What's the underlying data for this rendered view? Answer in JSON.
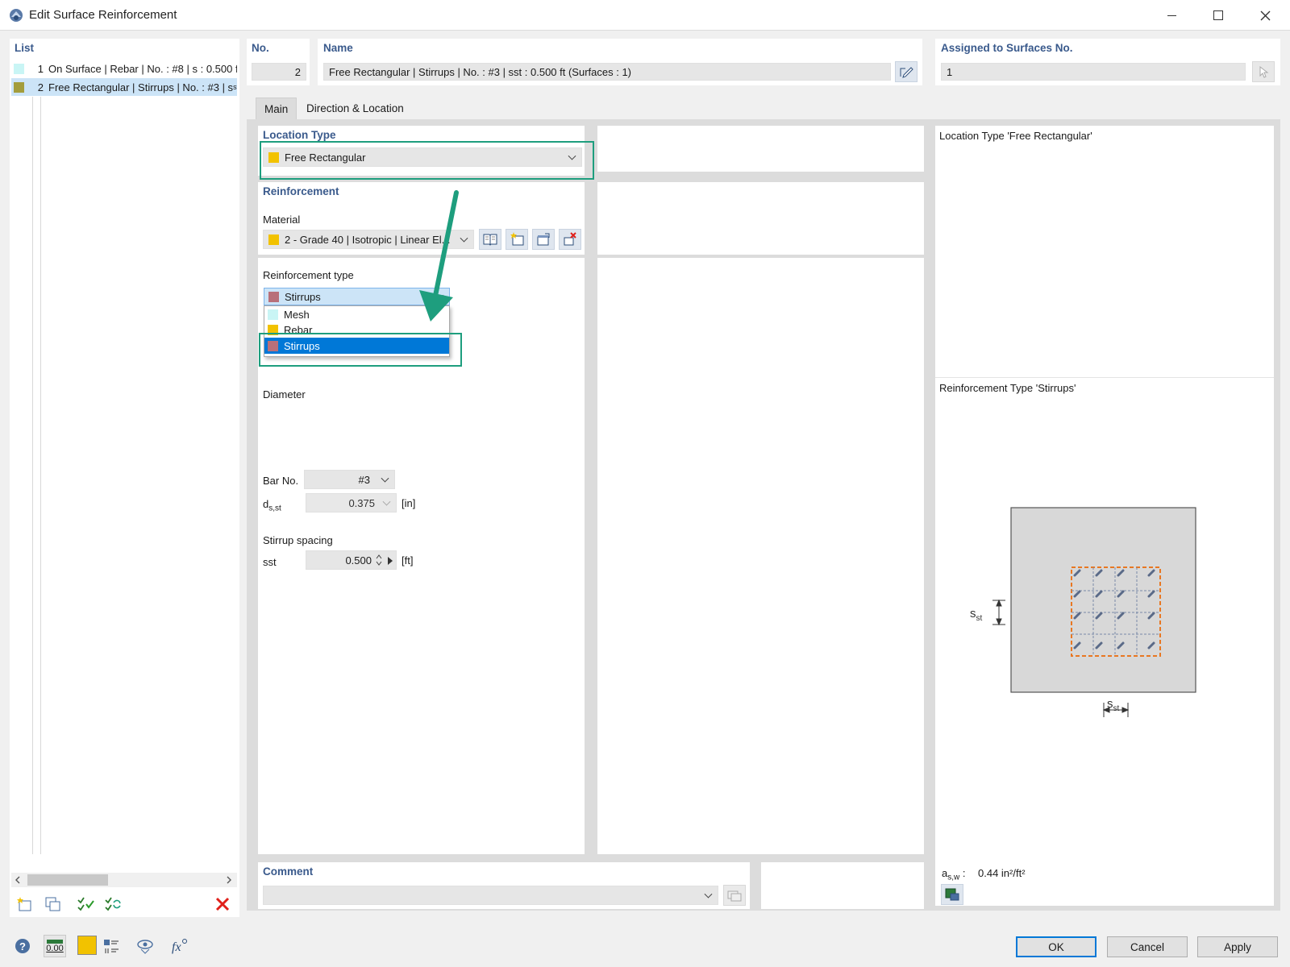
{
  "window": {
    "title": "Edit Surface Reinforcement"
  },
  "colors": {
    "accent": "#1e9e7e",
    "selection": "#0078d7",
    "mesh": "#c9f5f5",
    "rebar": "#f2c200",
    "stirrups": "#b8707a",
    "steel": "#a39d3c"
  },
  "list": {
    "header": "List",
    "items": [
      {
        "num": "1",
        "label": "On Surface | Rebar | No. : #8 | s : 0.500 ft"
      },
      {
        "num": "2",
        "label": "Free Rectangular | Stirrups | No. : #3 | s",
        "sub": "st"
      }
    ]
  },
  "header": {
    "no_label": "No.",
    "no_value": "2",
    "name_label": "Name",
    "name_value": "Free Rectangular | Stirrups | No. : #3 | sst : 0.500 ft (Surfaces : 1)",
    "assigned_label": "Assigned to Surfaces No.",
    "assigned_value": "1"
  },
  "tabs": [
    {
      "label": "Main"
    },
    {
      "label": "Direction & Location"
    }
  ],
  "location_type": {
    "title": "Location Type",
    "value": "Free Rectangular"
  },
  "reinforcement": {
    "title": "Reinforcement",
    "material_label": "Material",
    "material_value": "2 - Grade 40 | Isotropic | Linear El...",
    "type_label": "Reinforcement type",
    "type_value": "Stirrups",
    "options": [
      "Mesh",
      "Rebar",
      "Stirrups"
    ]
  },
  "diameter": {
    "title": "Diameter",
    "bar_no_label": "Bar No.",
    "bar_no_value": "#3",
    "ds_label": "d",
    "ds_sub": "s,st",
    "ds_value": "0.375",
    "ds_unit": "[in]"
  },
  "spacing": {
    "title": "Stirrup spacing",
    "label": "sst",
    "value": "0.500",
    "unit": "[ft]"
  },
  "preview": {
    "location_caption": "Location Type 'Free Rectangular'",
    "type_caption": "Reinforcement Type 'Stirrups'",
    "dim_label": "s",
    "dim_sub": "st",
    "asw_label": "a",
    "asw_sub": "s,w",
    "asw_value": "0.44 in²/ft²"
  },
  "comment": {
    "title": "Comment",
    "value": ""
  },
  "buttons": {
    "ok": "OK",
    "cancel": "Cancel",
    "apply": "Apply"
  },
  "footer_labels": {
    "zero": "0.00"
  }
}
